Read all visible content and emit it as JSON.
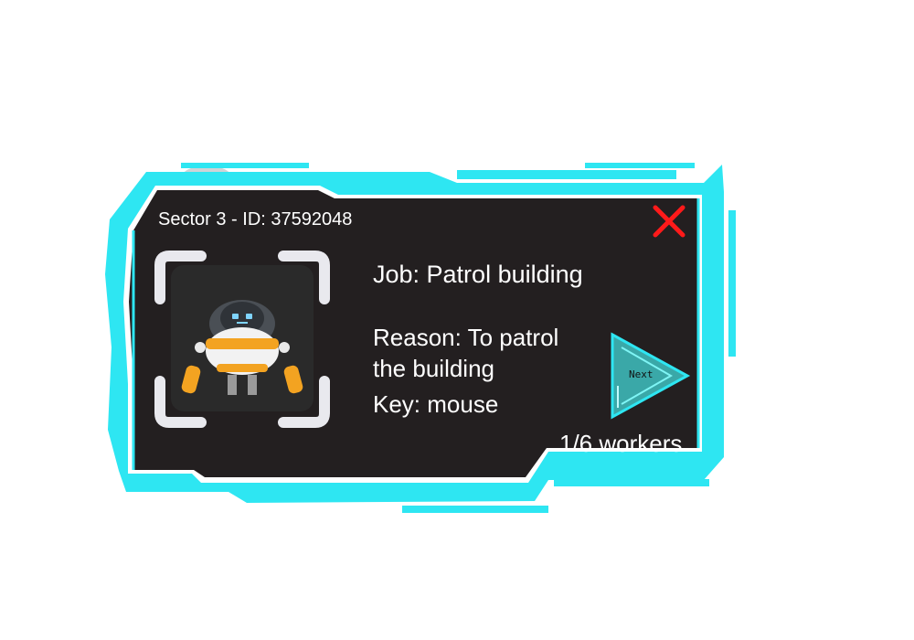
{
  "panel": {
    "header": "Sector 3 - ID: 37592048",
    "job": "Job: Patrol building",
    "reason": "Reason: To patrol the building",
    "key": "Key: mouse",
    "workers": "1/6 workers"
  },
  "buttons": {
    "close_icon": "close-icon",
    "next_label": "Next"
  },
  "colors": {
    "frame": "#2ee6f2",
    "panel": "#231f20",
    "close": "#ff1a1a",
    "next_fill": "#3aa8a8"
  }
}
